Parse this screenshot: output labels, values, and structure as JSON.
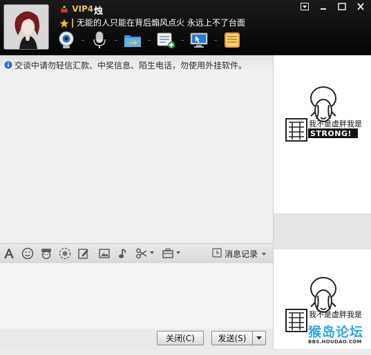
{
  "header": {
    "vip_label": "VIP4",
    "username": "烛",
    "signature": "无能的人只能在背后煽风点火 永远上不了台面"
  },
  "window_controls": [
    "menu",
    "minimize",
    "maximize",
    "close"
  ],
  "toolbar": {
    "icons": [
      "webcam-icon",
      "microphone-icon",
      "file-transfer-icon",
      "contact-card-icon",
      "remote-desktop-icon",
      "app-box-icon"
    ]
  },
  "notice": "交谈中请勿轻信汇款、中奖信息、陌生电话，勿使用外挂软件。",
  "input_toolbar": {
    "history_label": "消息记录"
  },
  "buttons": {
    "close": "关闭(C)",
    "send": "发送(S)"
  },
  "ads": [
    {
      "line1": "我不是虚胖我是",
      "line2": "STRONG!"
    },
    {
      "line1": "我不是虚胖我是"
    }
  ],
  "watermark": {
    "text": "猴岛论坛",
    "url": "BBS.HOUDAO.COM"
  },
  "colors": {
    "titlebar": "#0b0b0b",
    "gold": "#e8c15a",
    "panel": "#f0f0f0"
  }
}
